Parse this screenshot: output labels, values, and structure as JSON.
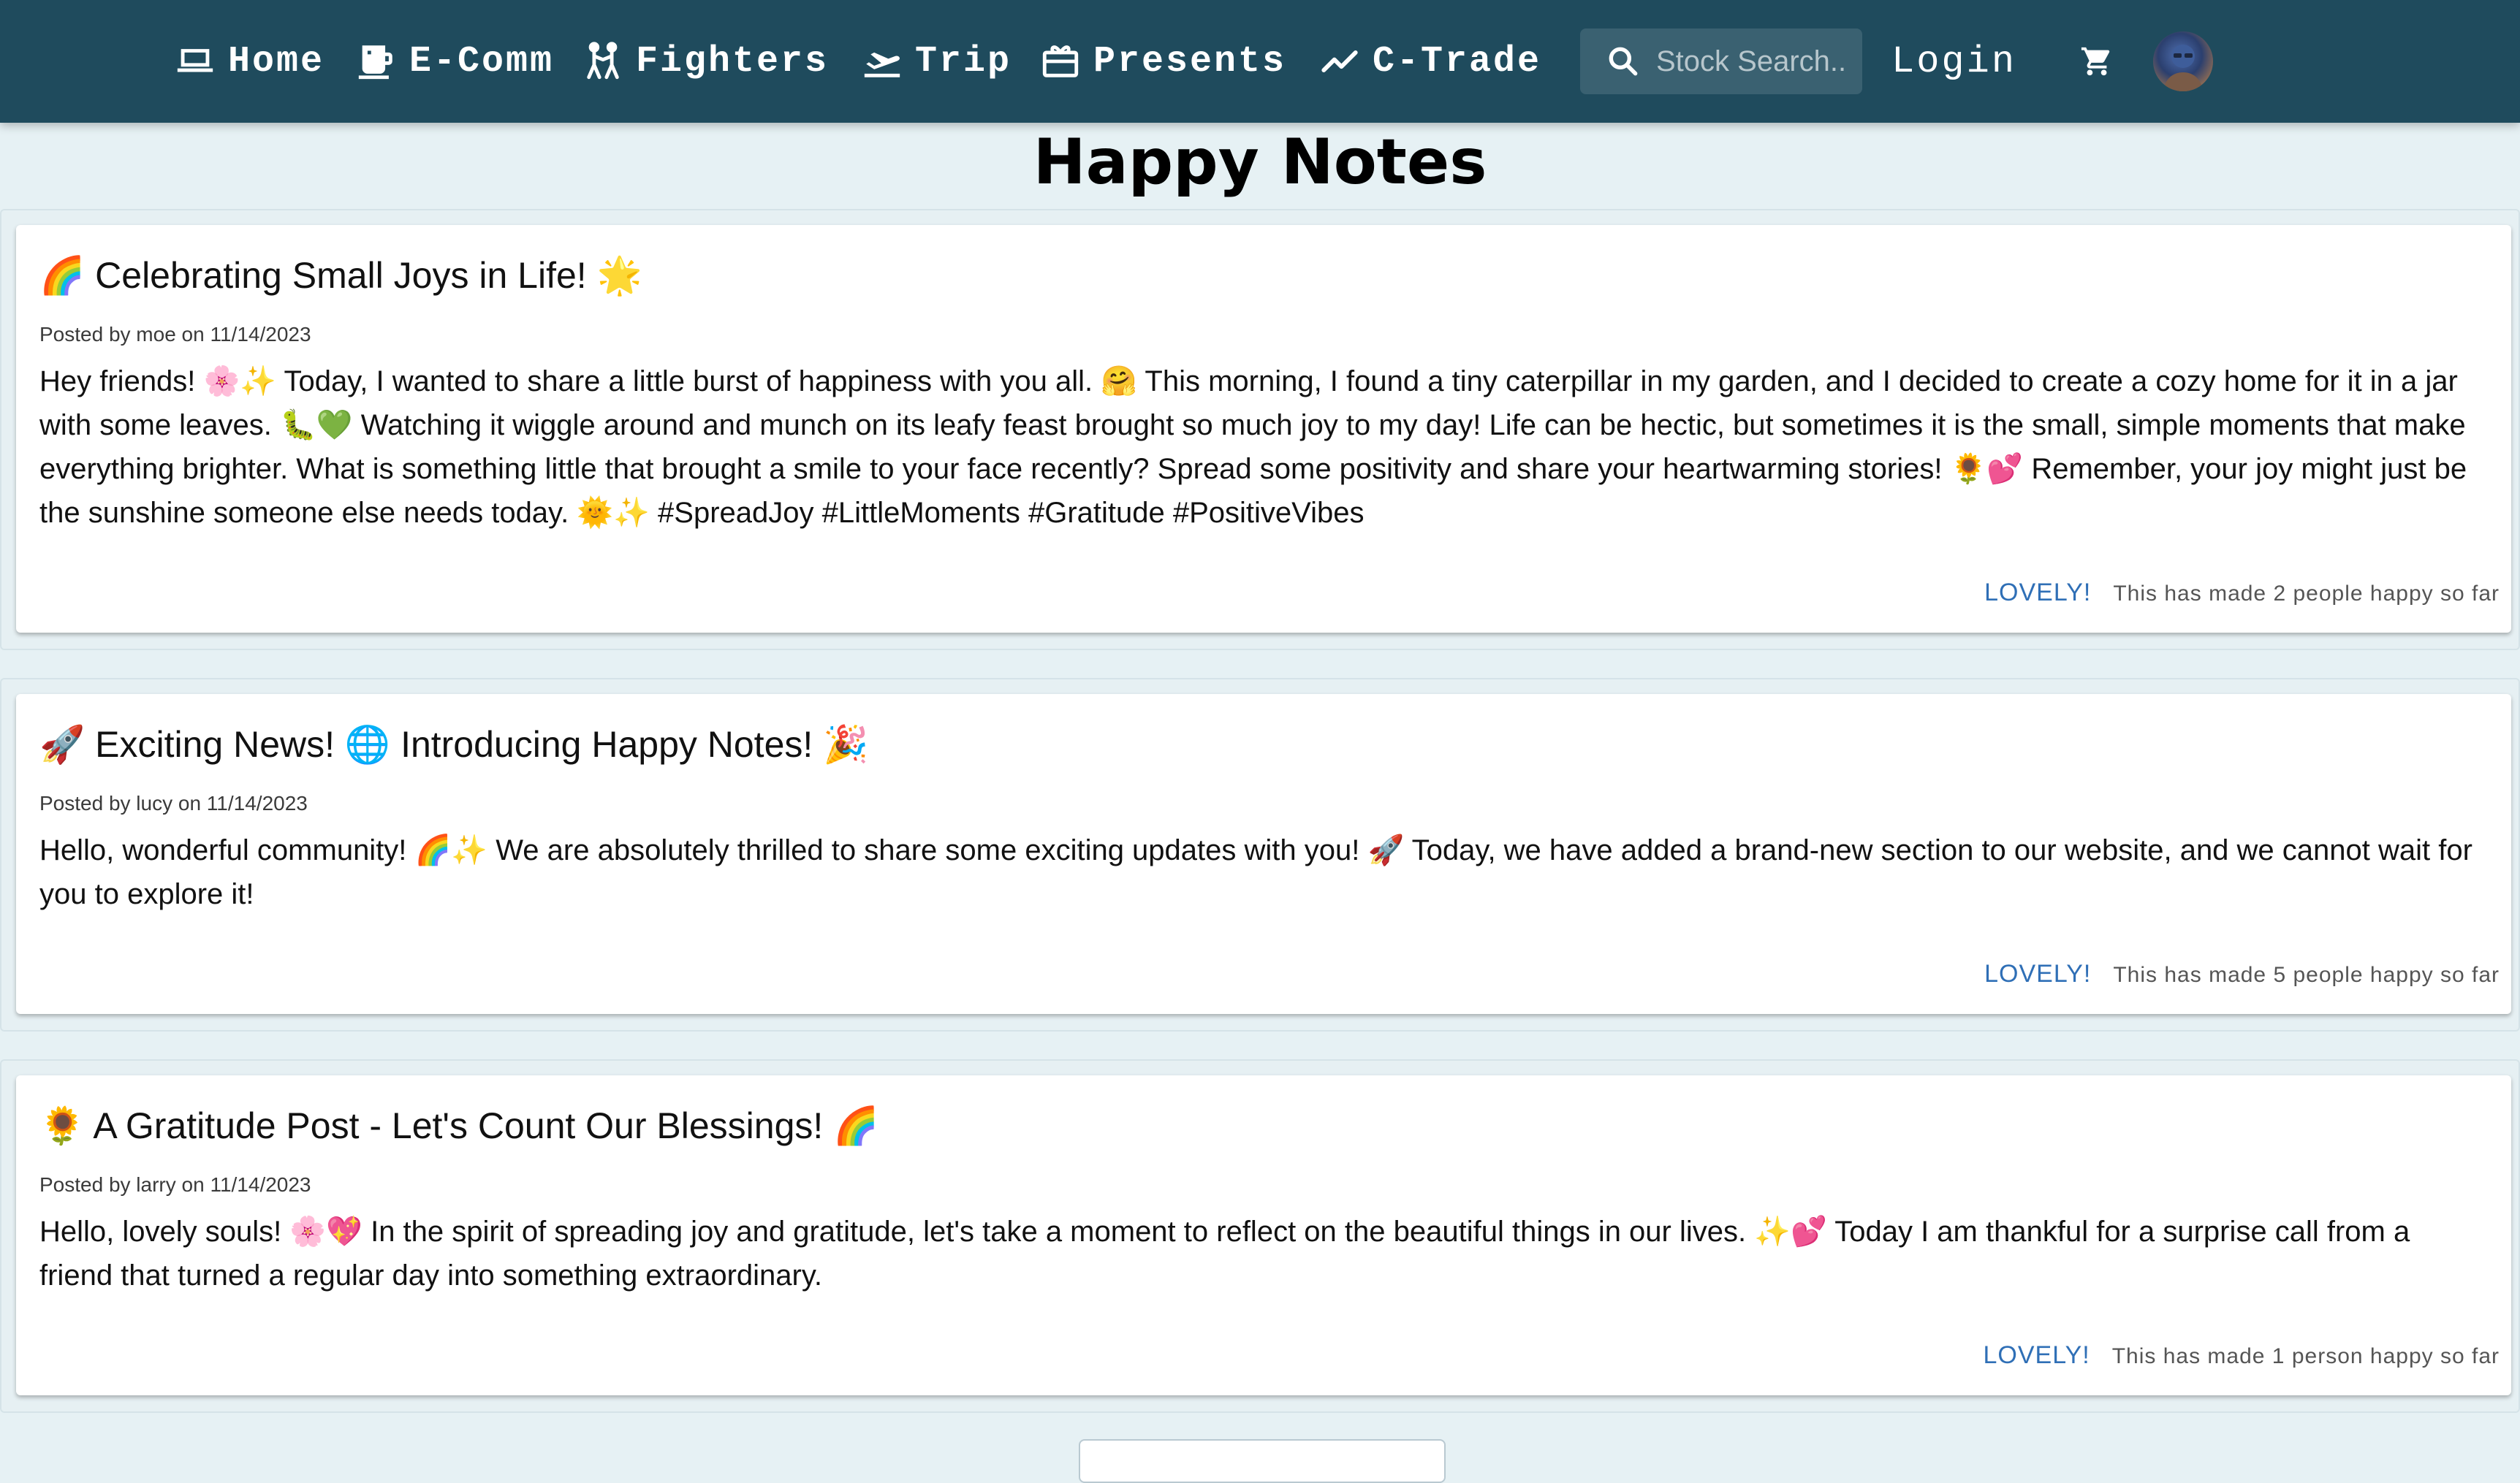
{
  "nav": {
    "items": [
      {
        "label": "Home",
        "icon": "laptop-icon"
      },
      {
        "label": "E-Comm",
        "icon": "mug-icon"
      },
      {
        "label": "Fighters",
        "icon": "fighters-icon"
      },
      {
        "label": "Trip",
        "icon": "airplane-icon"
      },
      {
        "label": "Presents",
        "icon": "gift-card-icon"
      },
      {
        "label": "C-Trade",
        "icon": "trending-icon"
      }
    ],
    "search": {
      "placeholder": "Stock Search.."
    },
    "login_label": "Login",
    "cart_icon": "cart-icon",
    "avatar_icon": "user-avatar"
  },
  "page": {
    "title": "Happy Notes"
  },
  "posts": [
    {
      "title": "🌈 Celebrating Small Joys in Life! 🌟",
      "meta": "Posted by moe on 11/14/2023",
      "body": "Hey friends! 🌸✨ Today, I wanted to share a little burst of happiness with you all. 🤗 This morning, I found a tiny caterpillar in my garden, and I decided to create a cozy home for it in a jar with some leaves. 🐛💚 Watching it wiggle around and munch on its leafy feast brought so much joy to my day! Life can be hectic, but sometimes it is the small, simple moments that make everything brighter. What is something little that brought a smile to your face recently? Spread some positivity and share your heartwarming stories! 🌻💕 Remember, your joy might just be the sunshine someone else needs today. 🌞✨ #SpreadJoy #LittleMoments #Gratitude #PositiveVibes",
      "lovely_label": "LOVELY!",
      "happy_text": "This has made 2 people happy so far"
    },
    {
      "title": "🚀 Exciting News! 🌐 Introducing Happy Notes! 🎉",
      "meta": "Posted by lucy on 11/14/2023",
      "body": "Hello, wonderful community! 🌈✨ We are absolutely thrilled to share some exciting updates with you! 🚀 Today, we have added a brand-new section to our website, and we cannot wait for you to explore it!",
      "lovely_label": "LOVELY!",
      "happy_text": "This has made 5 people happy so far"
    },
    {
      "title": "🌻 A Gratitude Post - Let's Count Our Blessings! 🌈",
      "meta": "Posted by larry on 11/14/2023",
      "body": "Hello, lovely souls! 🌸💖 In the spirit of spreading joy and gratitude, let's take a moment to reflect on the beautiful things in our lives. ✨💕 Today I am thankful for a surprise call from a friend that turned a regular day into something extraordinary.",
      "lovely_label": "LOVELY!",
      "happy_text": "This has made 1 person happy so far"
    }
  ]
}
